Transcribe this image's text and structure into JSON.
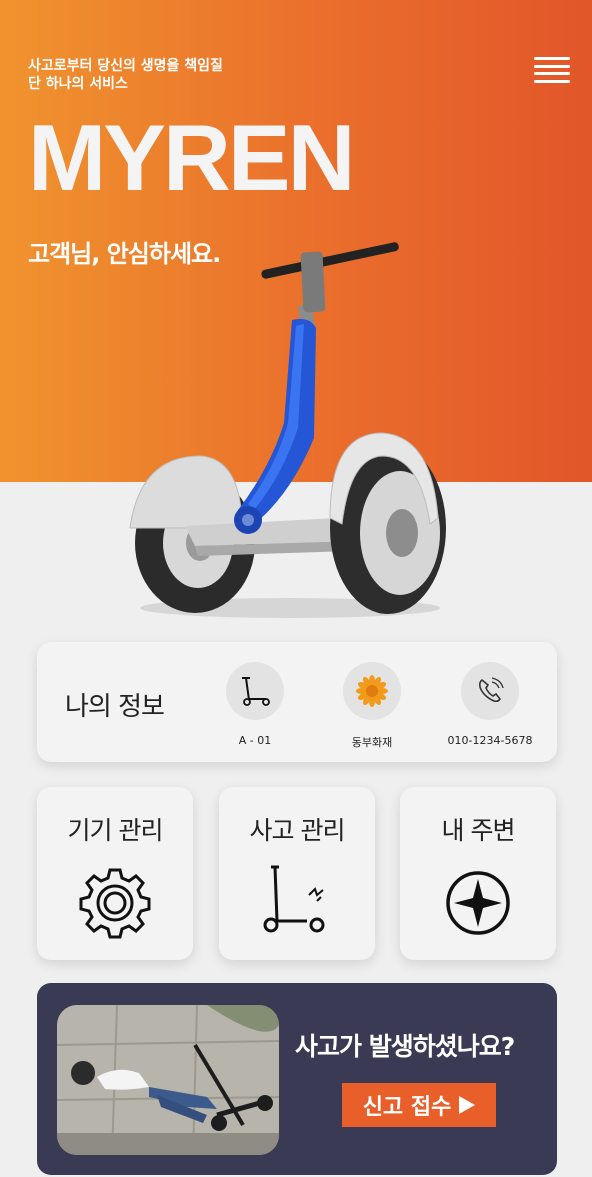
{
  "hero": {
    "tagline": "사고로부터 당신의 생명을 책임질\n단 하나의 서비스",
    "brand": "MYREN",
    "subtitle": "고객님, 안심하세요.",
    "colors": {
      "gradient_start": "#f0932e",
      "gradient_end": "#e2562a"
    }
  },
  "menu": {
    "icon": "hamburger-menu-icon"
  },
  "my_info": {
    "title": "나의 정보",
    "items": [
      {
        "icon": "kick-scooter-icon",
        "caption": "A - 01"
      },
      {
        "icon": "sunflower-icon",
        "caption": "동부화재"
      },
      {
        "icon": "phone-icon",
        "caption": "010-1234-5678"
      }
    ]
  },
  "features": [
    {
      "label": "기기 관리",
      "icon": "gear-icon"
    },
    {
      "label": "사고 관리",
      "icon": "scooter-crash-icon"
    },
    {
      "label": "내 주변",
      "icon": "compass-icon"
    }
  ],
  "banner": {
    "question": "사고가 발생하셨나요?",
    "button_label": "신고 접수",
    "button_color": "#e95f2a",
    "background": "#3a3a55"
  }
}
